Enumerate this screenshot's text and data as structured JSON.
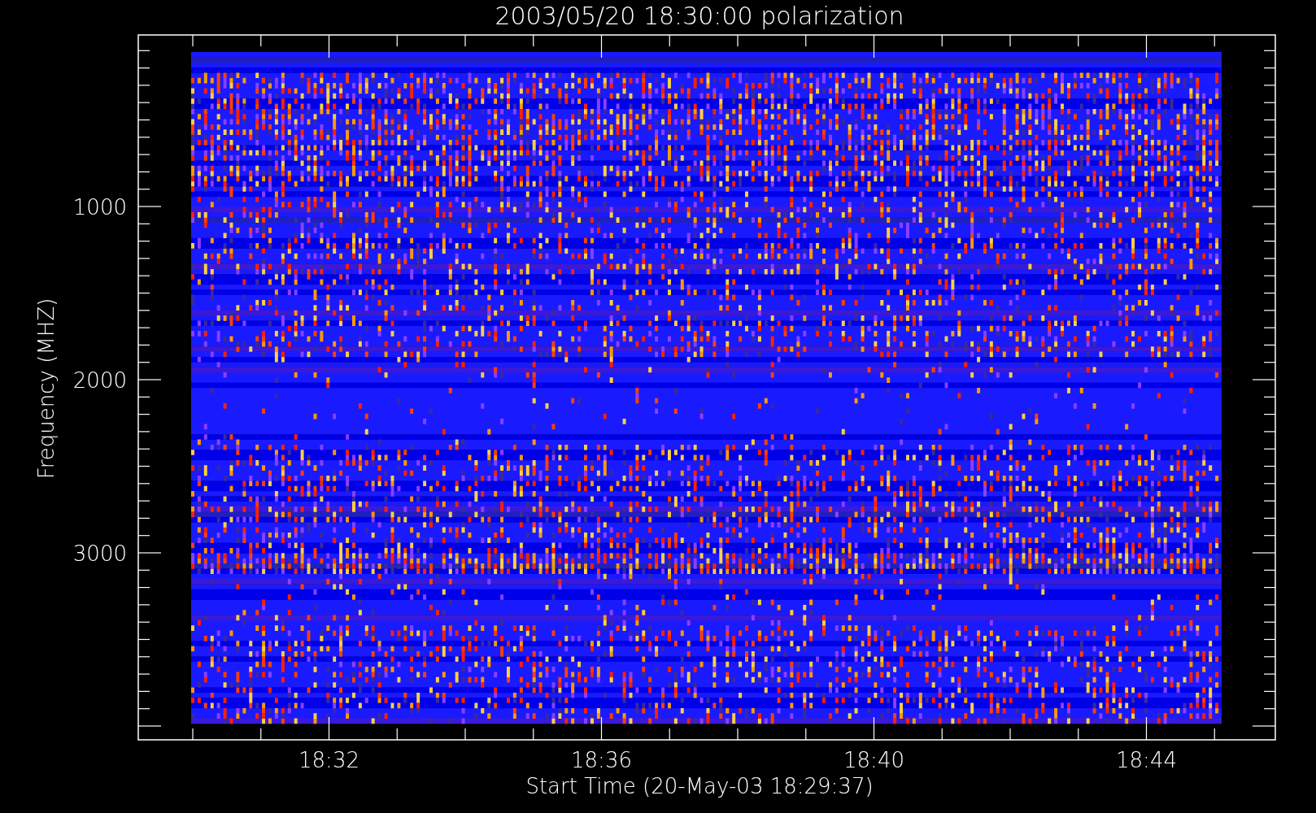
{
  "plot": {
    "title": "2003/05/20 18:30:00 polarization",
    "ylabel": "Frequency (MHZ)",
    "xlabel": "Start Time (20-May-03 18:29:37)",
    "ytick_labels": [
      "1000",
      "2000",
      "3000"
    ],
    "xtick_labels": [
      "18:32",
      "18:36",
      "18:40",
      "18:44"
    ]
  }
}
